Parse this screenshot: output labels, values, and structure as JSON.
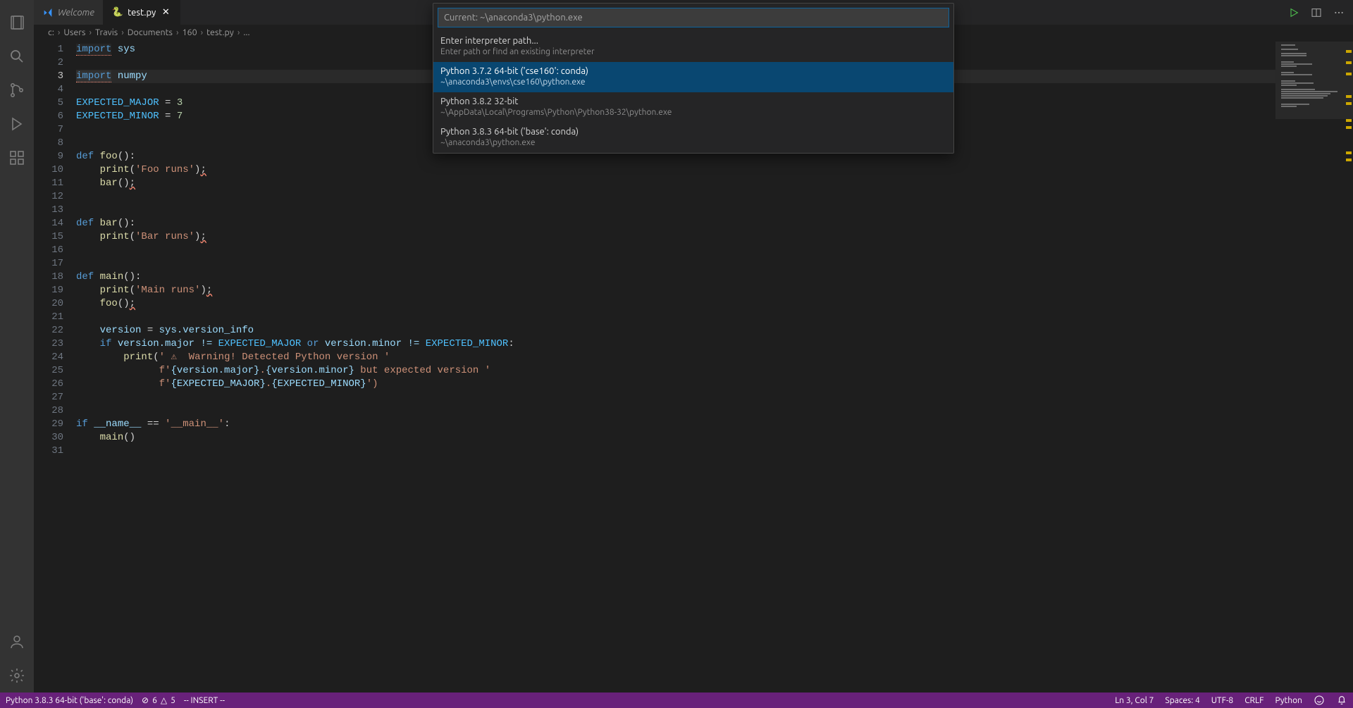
{
  "tabs": {
    "welcome": "Welcome",
    "file": "test.py"
  },
  "editor_actions": {
    "run": "Run",
    "split": "Split",
    "more": "More"
  },
  "breadcrumbs": [
    "c:",
    "Users",
    "Travis",
    "Documents",
    "160",
    "test.py",
    "..."
  ],
  "status": {
    "interpreter": "Python 3.8.3 64-bit ('base': conda)",
    "problems_err": "6",
    "problems_warn": "5",
    "mode": "-- INSERT --",
    "cursor": "Ln 3, Col 7",
    "spaces": "Spaces: 4",
    "encoding": "UTF-8",
    "eol": "CRLF",
    "lang": "Python"
  },
  "quickpick": {
    "placeholder": "Current: ~\\anaconda3\\python.exe",
    "items": [
      {
        "title": "Enter interpreter path...",
        "sub": "Enter path or find an existing interpreter"
      },
      {
        "title": "Python 3.7.2 64-bit ('cse160': conda)",
        "sub": "~\\anaconda3\\envs\\cse160\\python.exe"
      },
      {
        "title": "Python 3.8.2 32-bit",
        "sub": "~\\AppData\\Local\\Programs\\Python\\Python38-32\\python.exe"
      },
      {
        "title": "Python 3.8.3 64-bit ('base': conda)",
        "sub": "~\\anaconda3\\python.exe"
      }
    ],
    "selected_index": 1
  },
  "code": {
    "lines": 31,
    "current_line": 3,
    "l1_kw": "import",
    "l1_mod": "sys",
    "l3_kw": "import",
    "l3_mod": "numpy",
    "l5_a": "EXPECTED_MAJOR",
    "l5_eq": " = ",
    "l5_v": "3",
    "l6_a": "EXPECTED_MINOR",
    "l6_eq": " = ",
    "l6_v": "7",
    "l9_def": "def ",
    "l9_fn": "foo",
    "l9_sig": "():",
    "l10_ind": "    ",
    "l10_fn": "print",
    "l10_p": "(",
    "l10_s": "'Foo runs'",
    "l10_c": ")",
    "l10_semi": ";",
    "l11_ind": "    ",
    "l11_fn": "bar",
    "l11_c": "()",
    "l11_semi": ";",
    "l14_def": "def ",
    "l14_fn": "bar",
    "l14_sig": "():",
    "l15_ind": "    ",
    "l15_fn": "print",
    "l15_p": "(",
    "l15_s": "'Bar runs'",
    "l15_c": ")",
    "l15_semi": ";",
    "l18_def": "def ",
    "l18_fn": "main",
    "l18_sig": "():",
    "l19_ind": "    ",
    "l19_fn": "print",
    "l19_p": "(",
    "l19_s": "'Main runs'",
    "l19_c": ")",
    "l19_semi": ";",
    "l20_ind": "    ",
    "l20_fn": "foo",
    "l20_c": "()",
    "l20_semi": ";",
    "l22_ind": "    ",
    "l22_a": "version",
    "l22_eq": " = ",
    "l22_b": "sys.version_info",
    "l23_ind": "    ",
    "l23_if": "if ",
    "l23_a": "version.major != ",
    "l23_c1": "EXPECTED_MAJOR",
    "l23_or": " or ",
    "l23_b": "version.minor != ",
    "l23_c2": "EXPECTED_MINOR",
    "l23_colon": ":",
    "l24_ind": "        ",
    "l24_fn": "print",
    "l24_p": "(",
    "l24_s": "' ⚠  Warning! Detected Python version '",
    "l25_ind": "              ",
    "l25_f": "f'",
    "l25_b1": "{version.major}",
    "l25_dot": ".",
    "l25_b2": "{version.minor}",
    "l25_txt": " but expected version ",
    "l25_end": "'",
    "l26_ind": "              ",
    "l26_f": "f'",
    "l26_b1": "{EXPECTED_MAJOR}",
    "l26_dot": ".",
    "l26_b2": "{EXPECTED_MINOR}",
    "l26_end": "')",
    "l29_if": "if ",
    "l29_name": "__name__",
    "l29_eq": " == ",
    "l29_s": "'__main__'",
    "l29_colon": ":",
    "l30_ind": "    ",
    "l30_fn": "main",
    "l30_c": "()"
  }
}
